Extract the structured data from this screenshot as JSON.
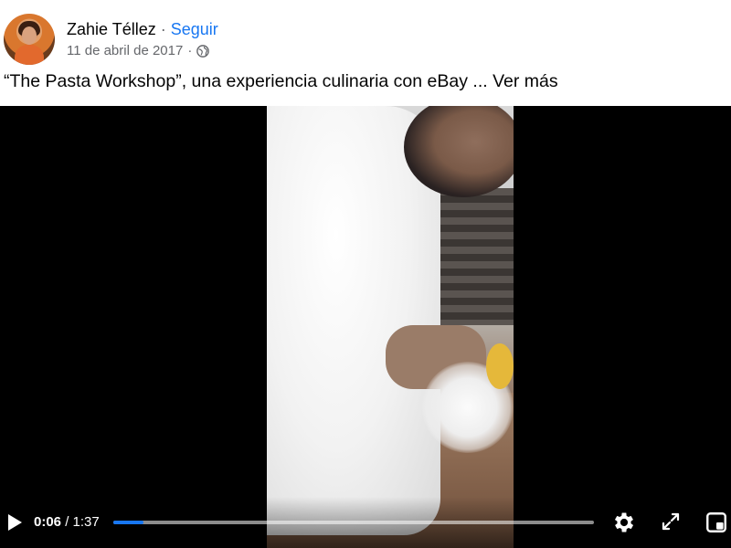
{
  "post": {
    "author": "Zahie Téllez",
    "separator": "·",
    "follow_label": "Seguir",
    "date": "11 de abril de 2017",
    "date_separator": "·",
    "privacy_icon": "globe-icon",
    "caption_text": "“The Pasta Workshop”, una experiencia culinaria con eBay ...",
    "see_more_label": "Ver más"
  },
  "video": {
    "current_time": "0:06",
    "time_separator": " / ",
    "duration": "1:37",
    "progress_fraction": 0.062,
    "progress_color": "#1877f2",
    "icons": [
      "play-icon",
      "settings-gear-icon",
      "fullscreen-icon",
      "miniplayer-icon"
    ]
  },
  "colors": {
    "link": "#1877f2",
    "secondary_text": "#65676b",
    "primary_text": "#050505",
    "video_bg": "#000000"
  }
}
